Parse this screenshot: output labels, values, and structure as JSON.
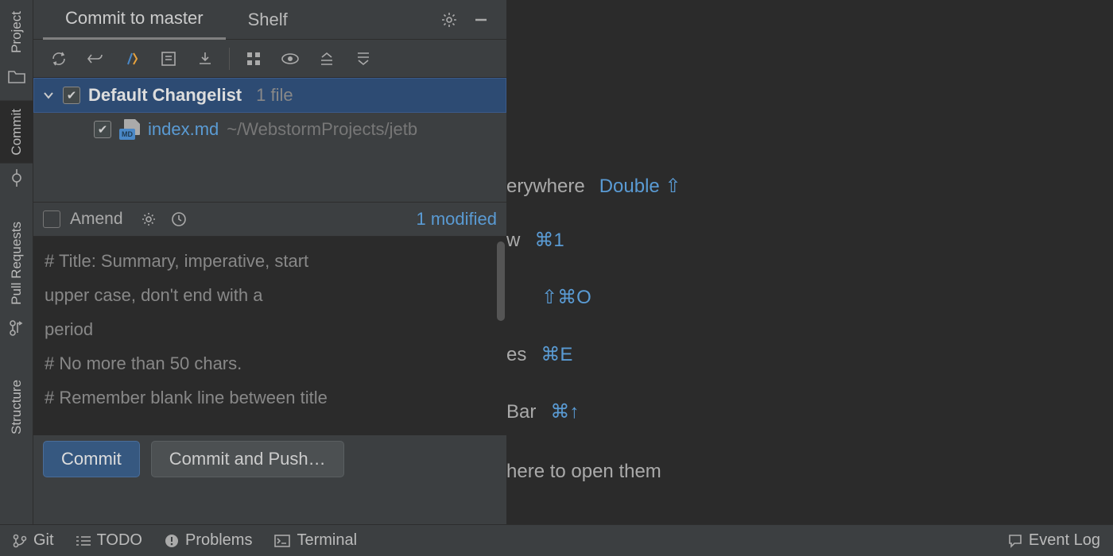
{
  "left_tabs": {
    "project": "Project",
    "commit": "Commit",
    "pull_requests": "Pull Requests",
    "structure": "Structure"
  },
  "commit_panel": {
    "tabs": {
      "commit_to": "Commit to master",
      "shelf": "Shelf"
    },
    "changelist": {
      "title": "Default Changelist",
      "count": "1 file"
    },
    "file": {
      "name": "index.md",
      "path": "~/WebstormProjects/jetb"
    },
    "amend_label": "Amend",
    "modified_label": "1 modified",
    "message_lines": [
      "# Title: Summary, imperative, start",
      "  upper case, don't end with a",
      "  period",
      "# No more than 50 chars.",
      "",
      "# Remember blank line between title"
    ],
    "buttons": {
      "commit": "Commit",
      "commit_push": "Commit and Push…"
    }
  },
  "welcome": {
    "row1_text": "erywhere",
    "row1_key_a": "Double",
    "row1_key_b": "⇧",
    "row2_text": "w",
    "row2_key": "⌘1",
    "row3_key": "⇧⌘O",
    "row4_text": "es",
    "row4_key": "⌘E",
    "row5_text": "Bar",
    "row5_key": "⌘↑",
    "row6_text": "here to open them"
  },
  "statusbar": {
    "git": "Git",
    "todo": "TODO",
    "problems": "Problems",
    "terminal": "Terminal",
    "event_log": "Event Log"
  }
}
